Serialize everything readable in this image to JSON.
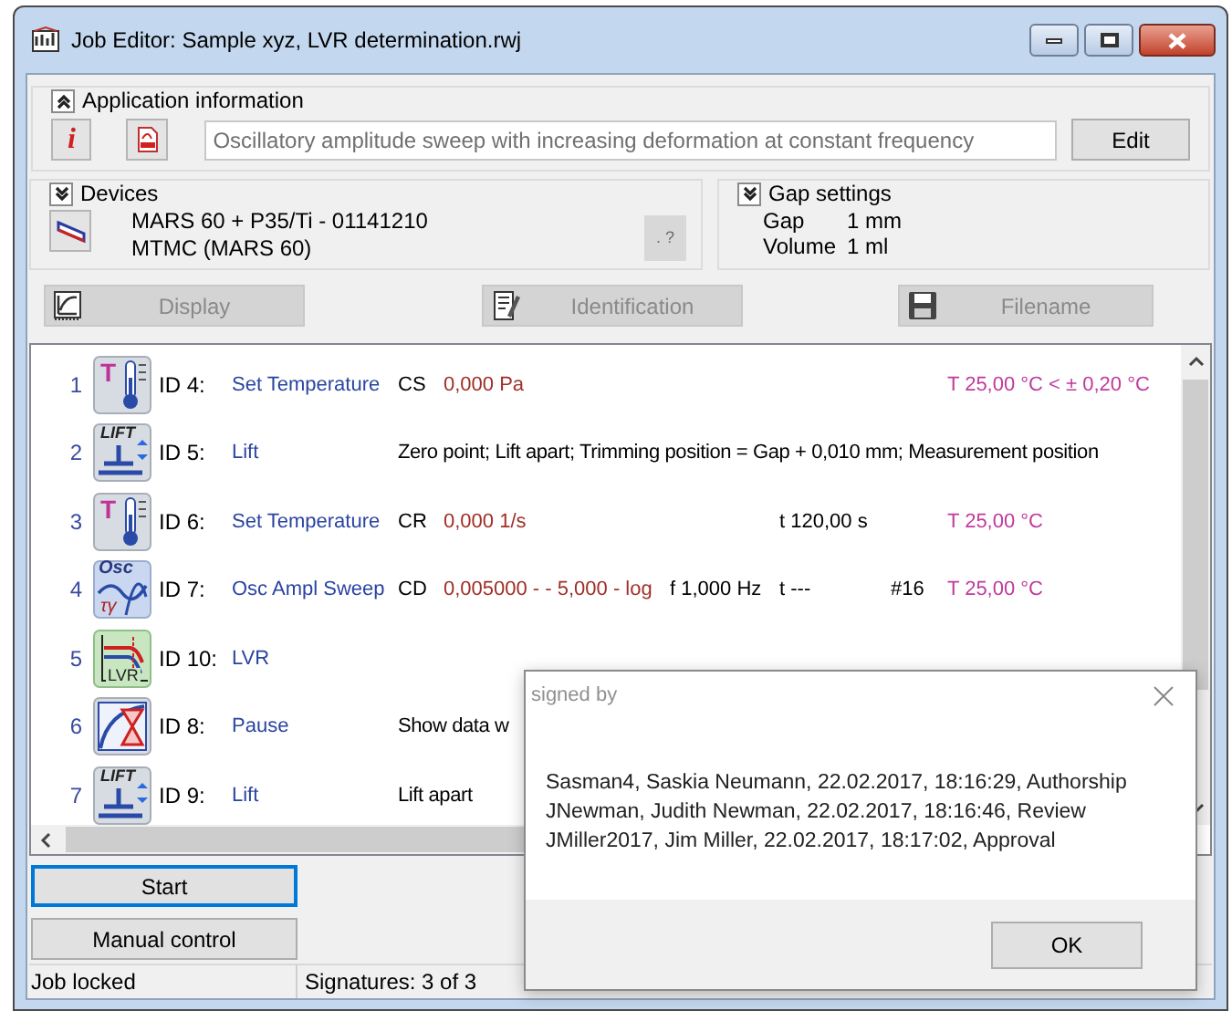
{
  "window": {
    "title": "Job Editor: Sample xyz, LVR determination.rwj"
  },
  "application_information": {
    "header": "Application information",
    "expanded": true,
    "info_button": "i",
    "description": "Oscillatory amplitude sweep with increasing deformation at constant frequency",
    "edit_button": "Edit"
  },
  "devices": {
    "header": "Devices",
    "expanded": false,
    "lines": [
      "MARS 60 + P35/Ti - 01141210",
      "MTMC (MARS 60)"
    ],
    "help_button": ". ?",
    "help_disabled": true
  },
  "gap_settings": {
    "header": "Gap settings",
    "expanded": false,
    "rows": [
      {
        "label": "Gap",
        "value": "1 mm"
      },
      {
        "label": "Volume",
        "value": "1 ml"
      }
    ]
  },
  "actions": [
    {
      "kind": "display",
      "label": "Display",
      "disabled": true
    },
    {
      "kind": "identification",
      "label": "Identification",
      "disabled": true
    },
    {
      "kind": "filename",
      "label": "Filename",
      "disabled": true
    }
  ],
  "steps": [
    {
      "number": "1",
      "kind": "thermo",
      "icon_text": "T",
      "id": "ID 4:",
      "name": "Set Temperature",
      "mode": "CS",
      "value": "0,000 Pa",
      "temp": "T 25,00 °C < ± 0,20 °C"
    },
    {
      "number": "2",
      "kind": "lift",
      "icon_text": "LIFT",
      "id": "ID 5:",
      "name": "Lift",
      "detail": "Zero point; Lift apart; Trimming position = Gap + 0,010 mm; Measurement position"
    },
    {
      "number": "3",
      "kind": "thermo",
      "icon_text": "T",
      "id": "ID 6:",
      "name": "Set Temperature",
      "mode": "CR",
      "value": "0,000 1/s",
      "time": "t 120,00 s",
      "temp": "T 25,00 °C"
    },
    {
      "number": "4",
      "kind": "osc",
      "icon_text": "Osc",
      "icon_subtext": "τγ",
      "id": "ID 7:",
      "name": "Osc Ampl Sweep",
      "mode": "CD",
      "value": "0,005000 - - 5,000 - log",
      "freq": "f 1,000 Hz",
      "time": "t ---",
      "count": "#16",
      "temp": "T 25,00 °C"
    },
    {
      "number": "5",
      "kind": "lvr",
      "icon_text": "LVR",
      "id": "ID 10:",
      "name": "LVR"
    },
    {
      "number": "6",
      "kind": "pause",
      "id": "ID 8:",
      "name": "Pause",
      "detail": "Show data w"
    },
    {
      "number": "7",
      "kind": "lift",
      "icon_text": "LIFT",
      "id": "ID 9:",
      "name": "Lift",
      "detail": "Lift apart"
    }
  ],
  "start_button": {
    "label": "Start",
    "focused": true
  },
  "manual_control_button": {
    "label": "Manual control",
    "focused": false
  },
  "status_bar": [
    "Job locked",
    "Signatures: 3 of 3"
  ],
  "dialog": {
    "title": "signed by",
    "lines": [
      "Sasman4, Saskia Neumann, 22.02.2017, 18:16:29, Authorship",
      "JNewman, Judith Newman, 22.02.2017, 18:16:46, Review",
      "JMiller2017, Jim Miller, 22.02.2017, 18:17:02, Approval"
    ],
    "ok_button": "OK"
  }
}
